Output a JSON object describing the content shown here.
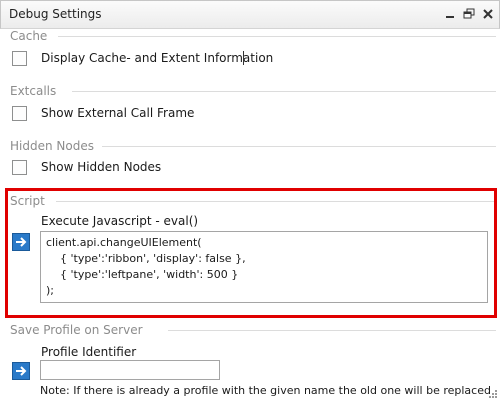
{
  "window": {
    "title": "Debug Settings",
    "buttons": [
      "minimize-icon",
      "restore-icon",
      "close-icon"
    ]
  },
  "sections": {
    "cache": {
      "legend": "Cache",
      "checkbox_label": "Display Cache- and Extent Information",
      "checked": false
    },
    "extcalls": {
      "legend": "Extcalls",
      "checkbox_label": "Show External Call Frame",
      "checked": false
    },
    "hidden_nodes": {
      "legend": "Hidden Nodes",
      "checkbox_label": "Show Hidden Nodes",
      "checked": false
    },
    "script": {
      "legend": "Script",
      "field_label": "Execute Javascript - eval()",
      "code": "client.api.changeUIElement(\n    { 'type':'ribbon', 'display': false },\n    { 'type':'leftpane', 'width': 500 }\n);",
      "run_icon": "arrow-right-icon"
    },
    "profile": {
      "legend": "Save Profile on Server",
      "field_label": "Profile Identifier",
      "value": "",
      "note": "Note: If there is already a profile with the given name the old one will be replaced",
      "run_icon": "arrow-right-icon"
    }
  },
  "colors": {
    "highlight": "#e00000",
    "button_blue": "#2a7ac9"
  }
}
